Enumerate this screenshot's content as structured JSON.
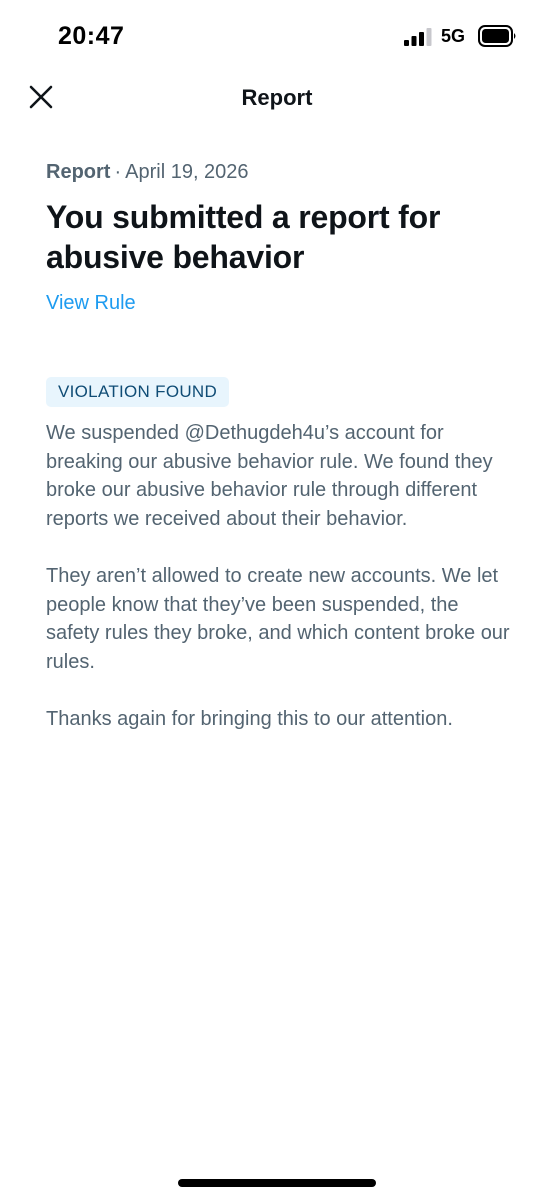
{
  "status_bar": {
    "time": "20:47",
    "network": "5G",
    "signal_icon": "cellular-signal-icon",
    "battery_icon": "battery-icon"
  },
  "header": {
    "title": "Report",
    "close_icon": "close-icon"
  },
  "report": {
    "type": "Report",
    "separator": "·",
    "date": "April 19, 2026",
    "title": "You submitted a report for abusive behavior",
    "view_rule_label": "View Rule",
    "badge": "VIOLATION FOUND",
    "paragraphs": [
      "We suspended @Dethugdeh4u’s account for breaking our abusive behavior rule. We found they broke our abusive behavior rule through different reports we received about their behavior.",
      "They aren’t allowed to create new accounts. We let people know that they’ve been suspended, the safety rules they broke, and which content broke our rules.",
      "Thanks again for bringing this to our attention."
    ]
  },
  "colors": {
    "text_primary": "#0f1419",
    "text_secondary": "#536471",
    "link": "#1d9bf0",
    "badge_bg": "#e8f5fd",
    "badge_text": "#0f4c75"
  }
}
